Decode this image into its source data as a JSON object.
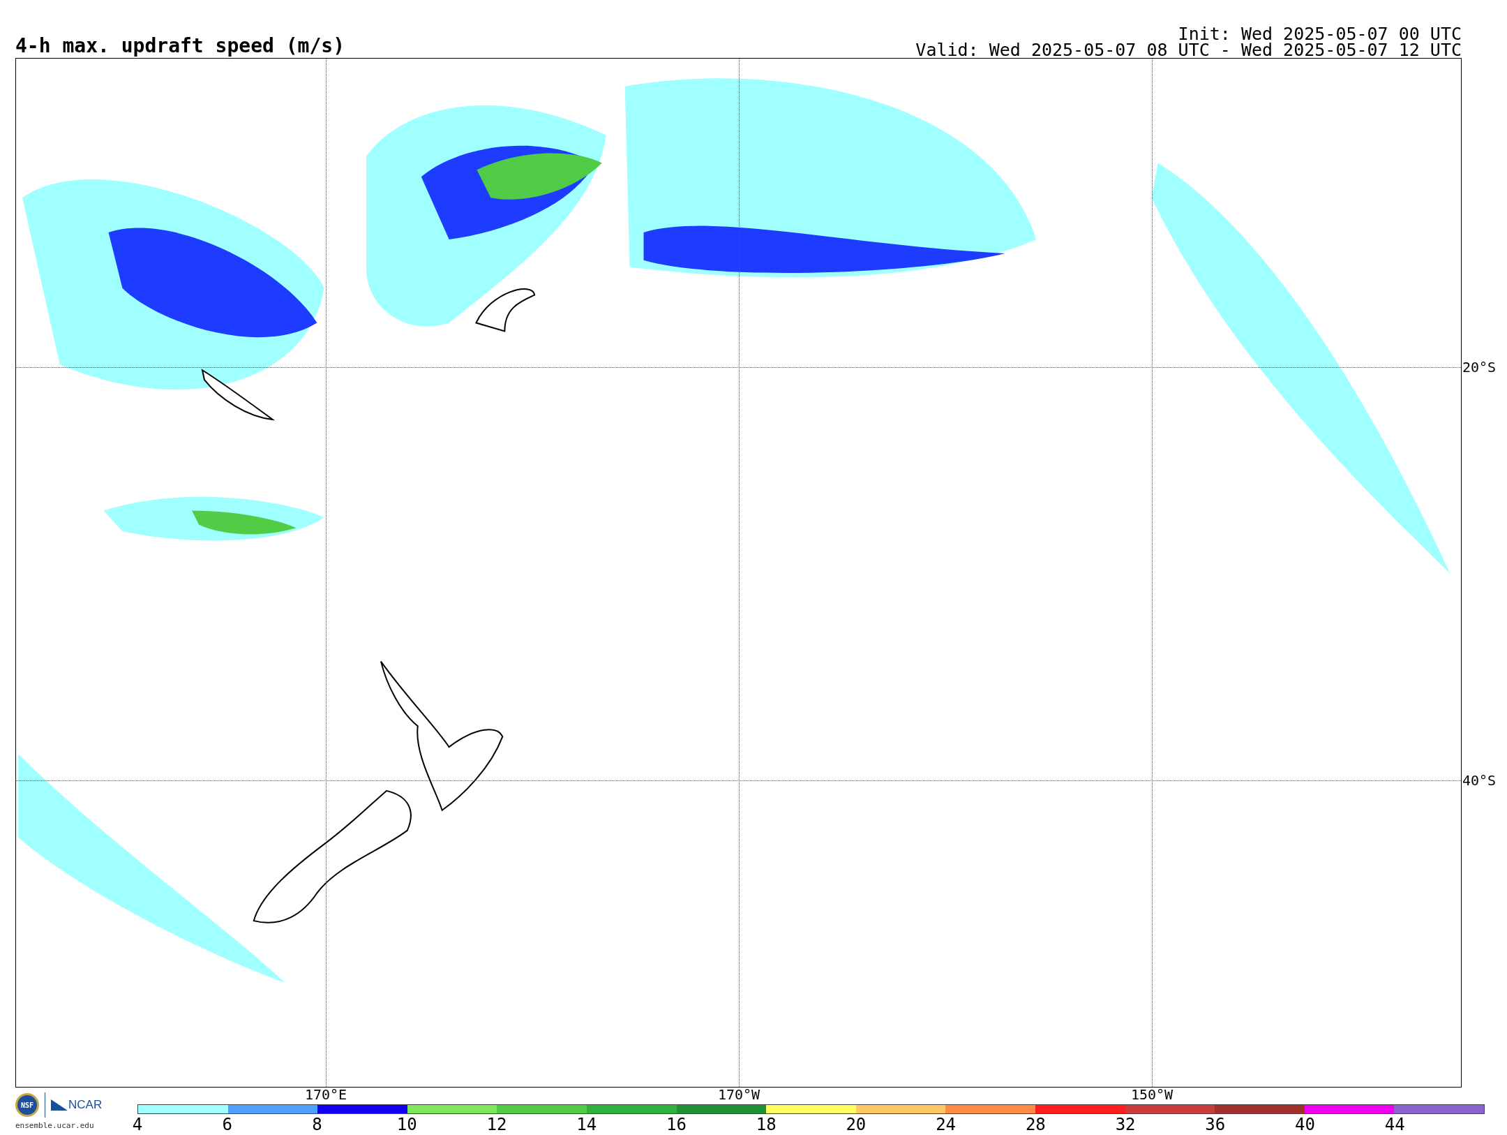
{
  "title": "4-h max. updraft speed (m/s)",
  "init": "Init: Wed 2025-05-07 00 UTC",
  "valid": "Valid: Wed 2025-05-07 08 UTC - Wed 2025-05-07 12 UTC",
  "map": {
    "longitude_labels": [
      "170°E",
      "170°W",
      "150°W"
    ],
    "latitude_labels": [
      "20°S",
      "40°S"
    ]
  },
  "logo": {
    "emblem": "NSF",
    "wordmark": "NCAR",
    "website": "ensemble.ucar.edu"
  },
  "colorbar": {
    "bins": [
      {
        "label": "4",
        "color": "#a0ffff"
      },
      {
        "label": "6",
        "color": "#50a0ff"
      },
      {
        "label": "8",
        "color": "#1400f0"
      },
      {
        "label": "10",
        "color": "#80e65a"
      },
      {
        "label": "12",
        "color": "#50cc46"
      },
      {
        "label": "14",
        "color": "#30b03c"
      },
      {
        "label": "16",
        "color": "#1e9038"
      },
      {
        "label": "18",
        "color": "#ffff60"
      },
      {
        "label": "20",
        "color": "#ffc864"
      },
      {
        "label": "24",
        "color": "#ff8c46"
      },
      {
        "label": "28",
        "color": "#ff1e1e"
      },
      {
        "label": "32",
        "color": "#c83c3c"
      },
      {
        "label": "36",
        "color": "#a0302c"
      },
      {
        "label": "40",
        "color": "#f000f0"
      },
      {
        "label": "44",
        "color": "#8c64d2"
      }
    ]
  }
}
